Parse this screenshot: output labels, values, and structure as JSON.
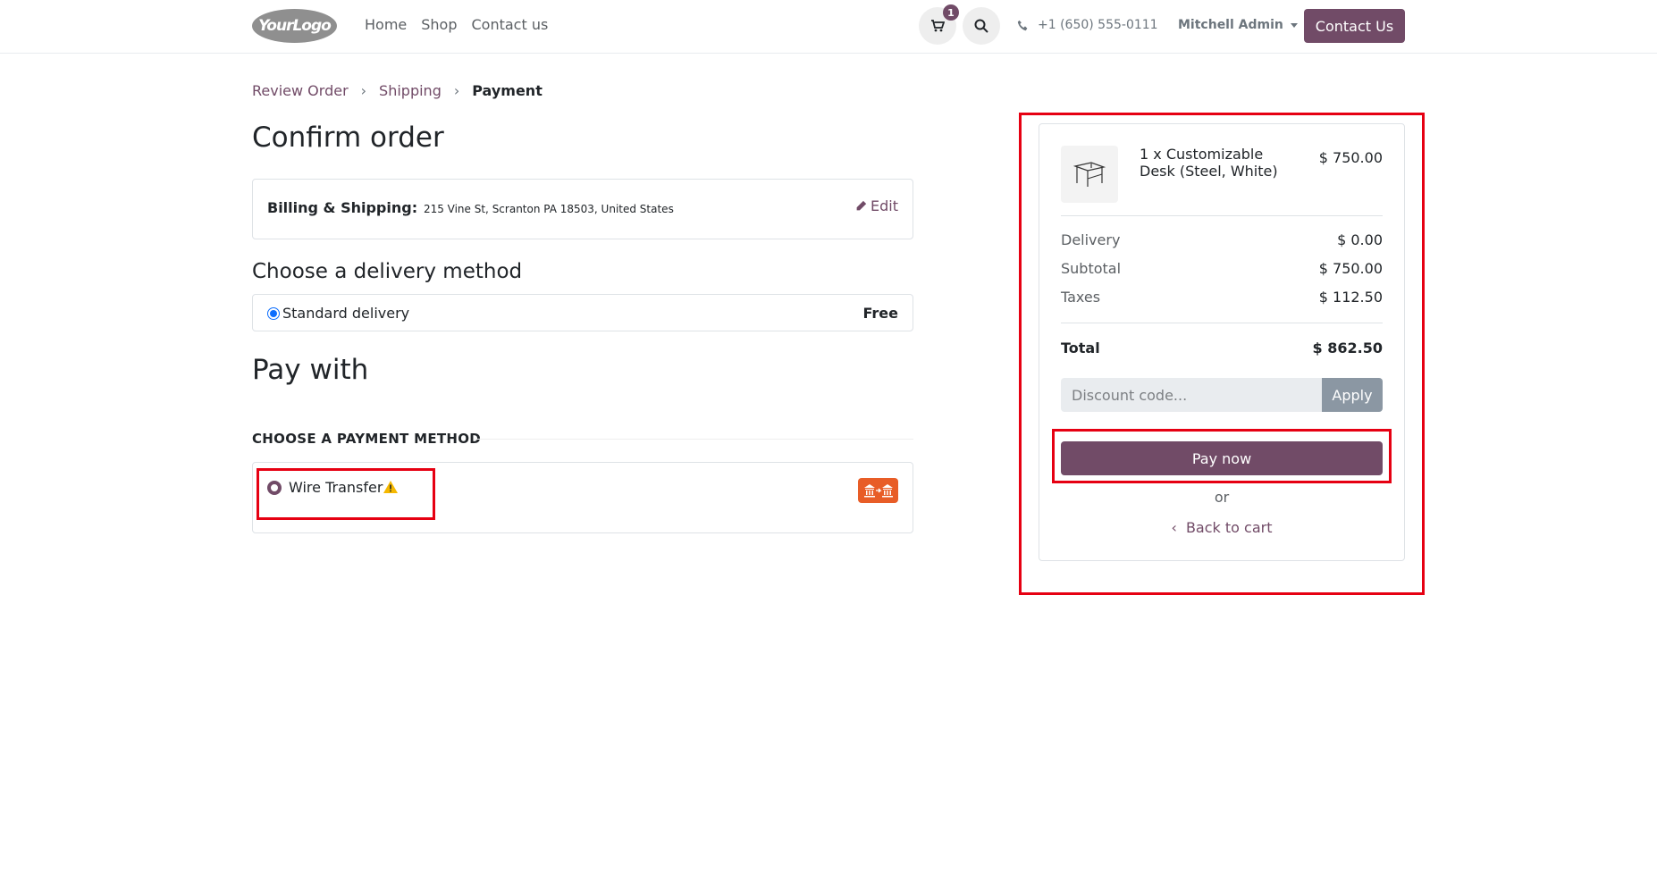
{
  "header": {
    "logo_text": "YourLogo",
    "nav": [
      "Home",
      "Shop",
      "Contact us"
    ],
    "cart_count": "1",
    "phone": "+1 (650) 555-0111",
    "user": "Mitchell Admin",
    "contact_button": "Contact Us"
  },
  "breadcrumb": {
    "step1": "Review Order",
    "step2": "Shipping",
    "step3": "Payment"
  },
  "main": {
    "title": "Confirm order",
    "billing_label": "Billing & Shipping:",
    "billing_address": "215 Vine St, Scranton PA 18503, United States",
    "edit_label": "Edit",
    "delivery_title": "Choose a delivery method",
    "delivery_option": "Standard delivery",
    "delivery_price": "Free",
    "pay_title": "Pay with",
    "payment_section": "CHOOSE A PAYMENT METHOD",
    "payment_method": "Wire Transfer"
  },
  "summary": {
    "product_name": "1 x Customizable Desk (Steel, White)",
    "product_price": "$ 750.00",
    "delivery_label": "Delivery",
    "delivery_value": "$ 0.00",
    "subtotal_label": "Subtotal",
    "subtotal_value": "$ 750.00",
    "taxes_label": "Taxes",
    "taxes_value": "$ 112.50",
    "total_label": "Total",
    "total_value": "$ 862.50",
    "discount_placeholder": "Discount code...",
    "apply_label": "Apply",
    "pay_now_label": "Pay now",
    "or_label": "or",
    "back_label": "Back to cart"
  },
  "colors": {
    "brand": "#714b67",
    "highlight": "#e60012",
    "wire_badge": "#e85d27"
  }
}
